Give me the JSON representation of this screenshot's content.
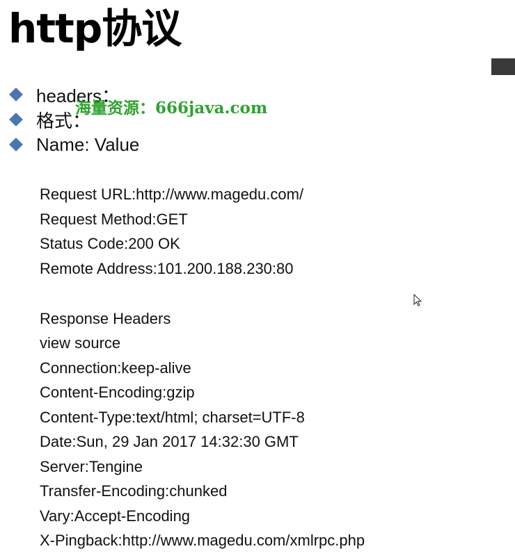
{
  "slide": {
    "title": "http协议",
    "bullets": [
      "headers：",
      "格式：",
      "Name: Value"
    ],
    "watermark": "海量资源：666java.com",
    "request_lines": [
      "Request URL:http://www.magedu.com/",
      "Request Method:GET",
      "Status Code:200 OK",
      "Remote Address:101.200.188.230:80"
    ],
    "response_lines": [
      "Response Headers",
      "view source",
      "Connection:keep-alive",
      "Content-Encoding:gzip",
      "Content-Type:text/html; charset=UTF-8",
      "Date:Sun, 29 Jan 2017 14:32:30 GMT",
      "Server:Tengine",
      "Transfer-Encoding:chunked",
      "Vary:Accept-Encoding",
      "X-Pingback:http://www.magedu.com/xmlrpc.php"
    ],
    "colors": {
      "bullet": "#4a74b5",
      "watermark": "#2ea32e",
      "corner_box": "#3a3a3a"
    },
    "icons": {
      "bullet": "diamond-bullet-icon",
      "cursor": "mouse-pointer-icon"
    }
  }
}
